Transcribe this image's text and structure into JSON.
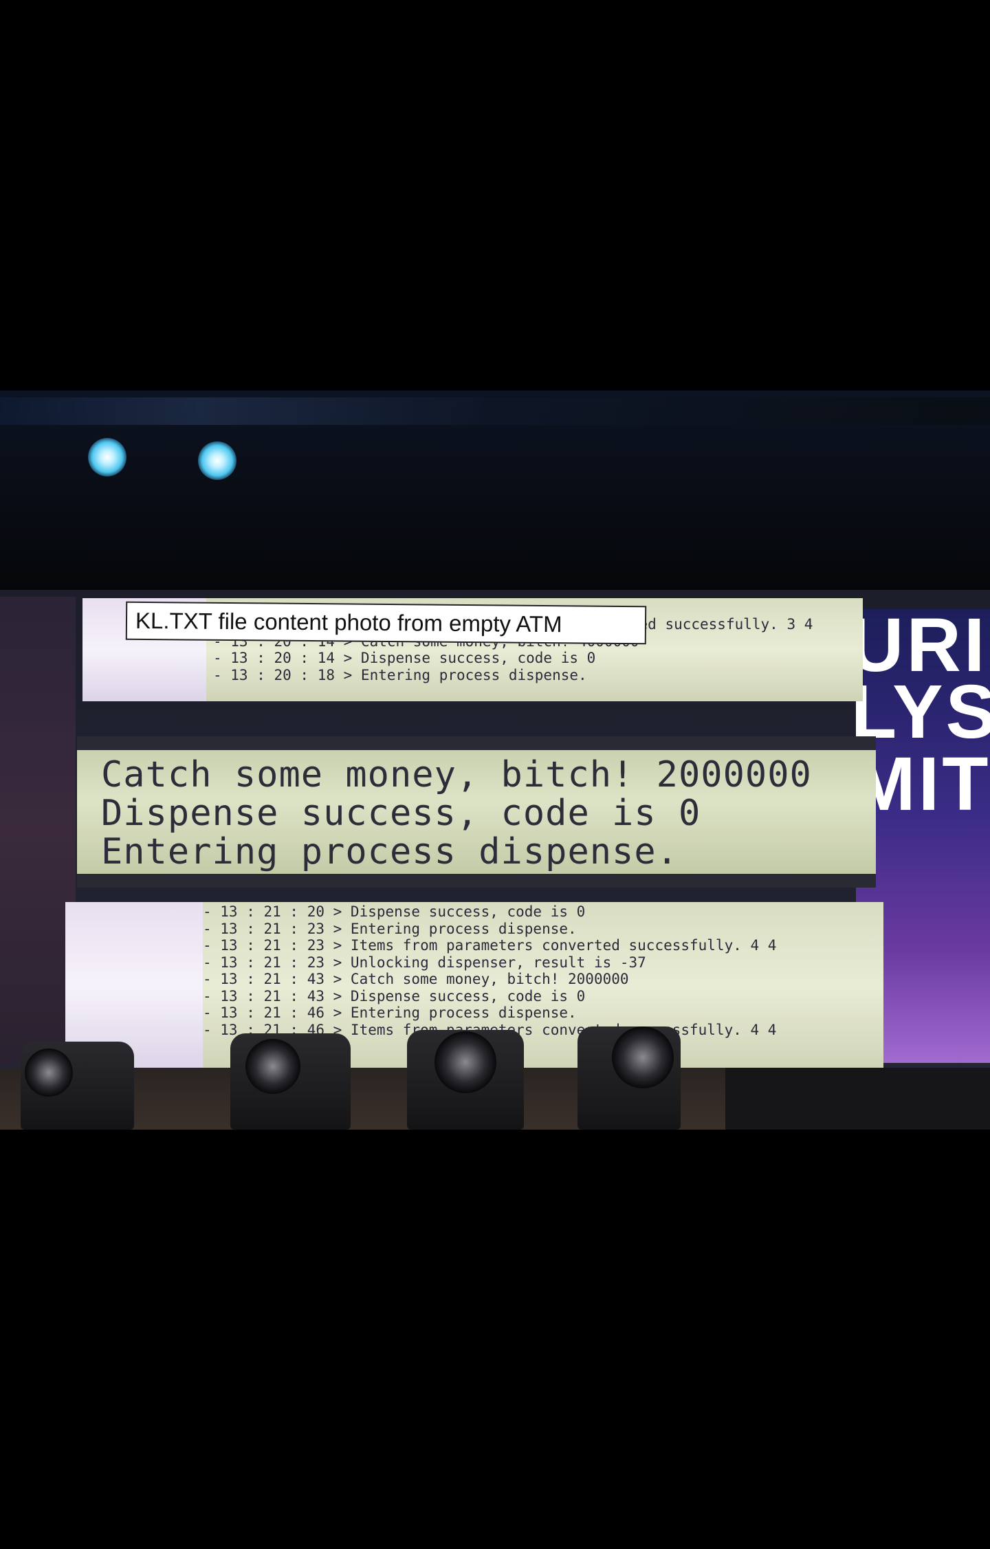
{
  "caption": "KL.TXT file content photo from empty ATM",
  "banner": {
    "lines": [
      "URI",
      "LYS",
      "MIT"
    ]
  },
  "log_top": {
    "lines": [
      "                                              erted successfully. 3 4",
      "- 13 : 20 : 14 > Catch some money, bitch! 4000000",
      "- 13 : 20 : 14 > Dispense success, code is 0",
      "- 13 : 20 : 18 > Entering process dispense."
    ]
  },
  "zoom": {
    "lines": [
      "Catch some money, bitch! 2000000",
      "Dispense success, code is 0",
      "Entering process dispense."
    ]
  },
  "log_bottom": {
    "lines": [
      "- 13 : 21 : 20 > Dispense success, code is 0",
      "- 13 : 21 : 23 > Entering process dispense.",
      "- 13 : 21 : 23 > Items from parameters converted successfully. 4 4",
      "- 13 : 21 : 23 > Unlocking dispenser, result is -37",
      "- 13 : 21 : 43 > Catch some money, bitch! 2000000",
      "- 13 : 21 : 43 > Dispense success, code is 0",
      "- 13 : 21 : 46 > Entering process dispense.",
      "- 13 : 21 : 46 > Items from parameters converted successfully. 4 4"
    ]
  }
}
